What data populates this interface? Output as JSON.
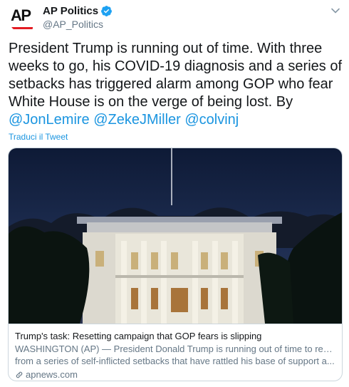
{
  "account": {
    "display_name": "AP Politics",
    "handle": "@AP_Politics",
    "avatar_text": "AP",
    "verified": true
  },
  "tweet": {
    "text": "President Trump is running out of time. With three weeks to go, his COVID-19 diagnosis and a series of setbacks has triggered alarm among GOP who fear White House is on the verge of being lost. By",
    "mentions": [
      "@JonLemire",
      "@ZekeJMiller",
      "@colvinj"
    ],
    "translate_label": "Traduci il Tweet"
  },
  "card": {
    "title": "Trump's task: Resetting campaign that GOP fears is slipping",
    "description_line1": "WASHINGTON (AP) — President Donald Trump is running out of time to recover",
    "description_line2": "from a series of self-inflicted setbacks that have rattled his base of support a...",
    "domain": "apnews.com",
    "image_subject": "White House at night"
  },
  "colors": {
    "link": "#1b95e0",
    "secondary_text": "#657786",
    "border": "#ccd6dd",
    "verified": "#1da1f2",
    "ap_red": "#e31b23"
  },
  "icons": {
    "verified": "verified-badge-icon",
    "more": "chevron-down-icon",
    "link": "link-icon"
  }
}
